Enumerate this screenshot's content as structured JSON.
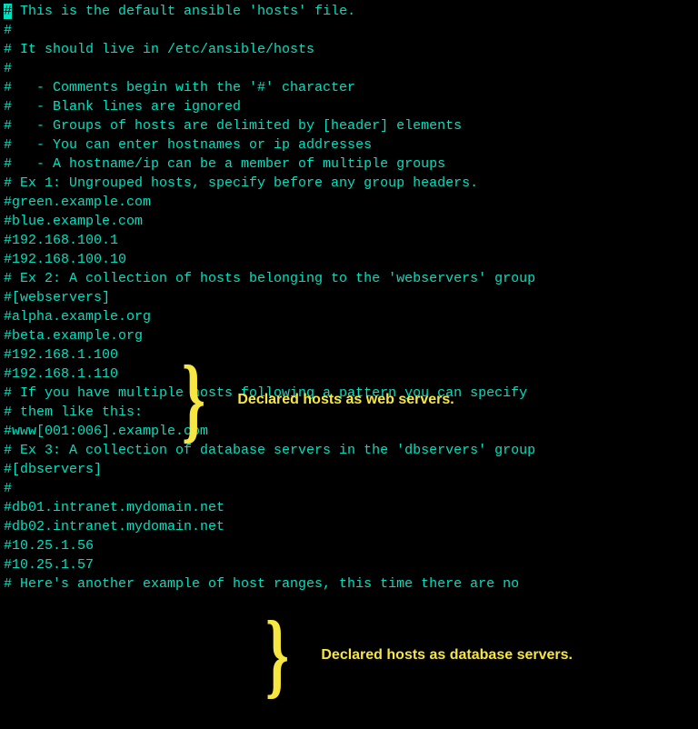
{
  "lines": {
    "l0a": "#",
    "l0b": " This is the default ansible 'hosts' file.",
    "l1": "#",
    "l2": "# It should live in /etc/ansible/hosts",
    "l3": "#",
    "l4": "#   - Comments begin with the '#' character",
    "l5": "#   - Blank lines are ignored",
    "l6": "#   - Groups of hosts are delimited by [header] elements",
    "l7": "#   - You can enter hostnames or ip addresses",
    "l8": "#   - A hostname/ip can be a member of multiple groups",
    "l9": "",
    "l10": "# Ex 1: Ungrouped hosts, specify before any group headers.",
    "l11": "",
    "l12": "#green.example.com",
    "l13": "#blue.example.com",
    "l14": "#192.168.100.1",
    "l15": "#192.168.100.10",
    "l16": "",
    "l17": "# Ex 2: A collection of hosts belonging to the 'webservers' group",
    "l18": "",
    "l19": "#[webservers]",
    "l20": "#alpha.example.org",
    "l21": "#beta.example.org",
    "l22": "#192.168.1.100",
    "l23": "#192.168.1.110",
    "l24": "",
    "l25": "# If you have multiple hosts following a pattern you can specify",
    "l26": "# them like this:",
    "l27": "",
    "l28": "#www[001:006].example.com",
    "l29": "",
    "l30": "# Ex 3: A collection of database servers in the 'dbservers' group",
    "l31": "",
    "l32": "#[dbservers]",
    "l33": "#",
    "l34": "#db01.intranet.mydomain.net",
    "l35": "#db02.intranet.mydomain.net",
    "l36": "#10.25.1.56",
    "l37": "#10.25.1.57",
    "l38": "",
    "l39": "# Here's another example of host ranges, this time there are no"
  },
  "annotations": {
    "web": "Declared hosts as web servers.",
    "db": "Declared hosts as database servers."
  },
  "brace": "}"
}
